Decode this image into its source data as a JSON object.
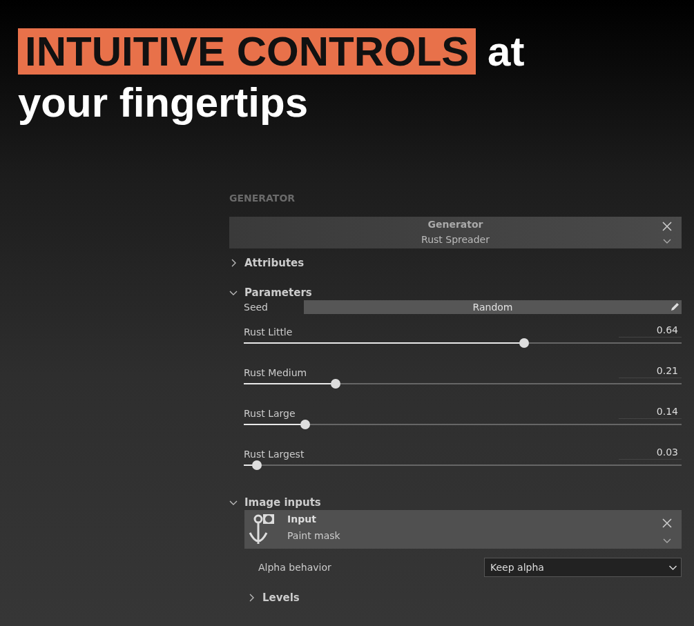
{
  "headline": {
    "highlight": "INTUITIVE CONTROLS",
    "rest": "at",
    "line2": "your fingertips"
  },
  "panel": {
    "title": "GENERATOR",
    "generator": {
      "title": "Generator",
      "value": "Rust Spreader"
    },
    "sections": [
      {
        "kind": "collapsed",
        "label": "Attributes",
        "expanded": false
      },
      {
        "kind": "parameters",
        "label": "Parameters",
        "expanded": true,
        "seed": {
          "label": "Seed",
          "value": "Random"
        },
        "sliders": [
          {
            "label": "Rust Little",
            "reading": "0.64",
            "level": 0.64
          },
          {
            "label": "Rust Medium",
            "reading": "0.21",
            "level": 0.21
          },
          {
            "label": "Rust Large",
            "reading": "0.14",
            "level": 0.14
          },
          {
            "label": "Rust Largest",
            "reading": "0.03",
            "level": 0.03
          }
        ]
      },
      {
        "kind": "inputs",
        "label": "Image inputs",
        "expanded": true,
        "input": {
          "title": "Input",
          "value": "Paint mask"
        },
        "alpha": {
          "label": "Alpha behavior",
          "value": "Keep alpha"
        },
        "levels": {
          "label": "Levels",
          "expanded": false
        }
      }
    ]
  }
}
